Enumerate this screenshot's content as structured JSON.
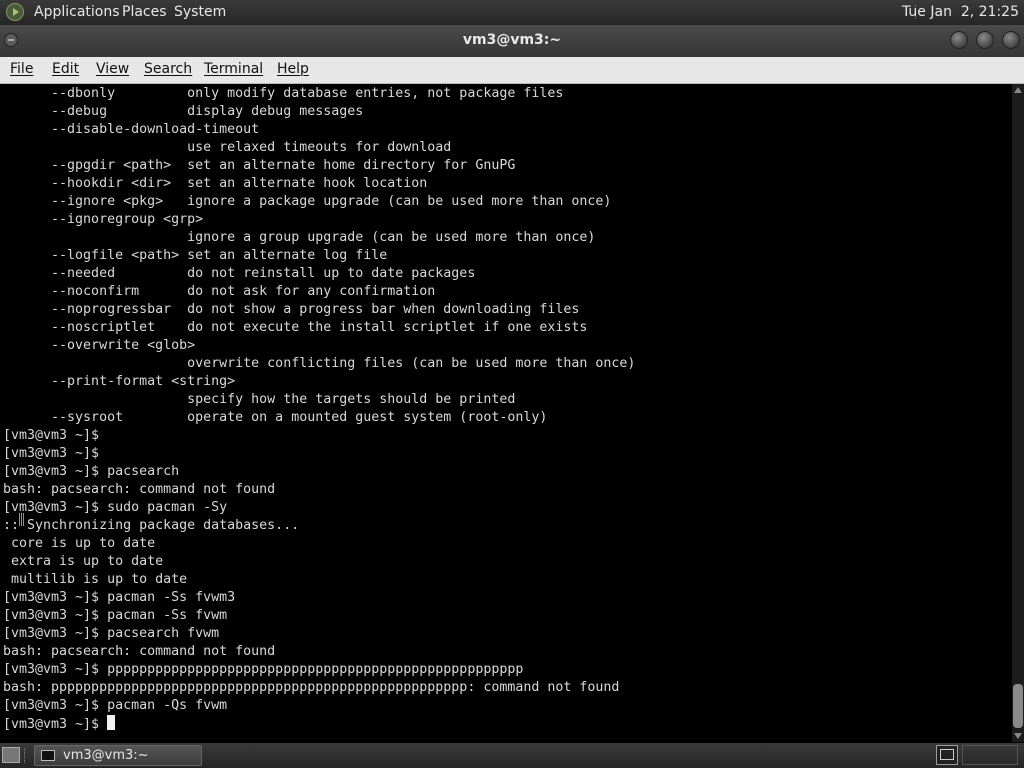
{
  "top_panel": {
    "menus": [
      "Applications",
      "Places",
      "System"
    ],
    "clock": "Tue Jan  2, 21:25"
  },
  "window": {
    "title": "vm3@vm3:~"
  },
  "menubar": {
    "items": [
      "File",
      "Edit",
      "View",
      "Search",
      "Terminal",
      "Help"
    ]
  },
  "terminal": {
    "lines": [
      "      --dbonly         only modify database entries, not package files",
      "      --debug          display debug messages",
      "      --disable-download-timeout",
      "                       use relaxed timeouts for download",
      "      --gpgdir <path>  set an alternate home directory for GnuPG",
      "      --hookdir <dir>  set an alternate hook location",
      "      --ignore <pkg>   ignore a package upgrade (can be used more than once)",
      "      --ignoregroup <grp>",
      "                       ignore a group upgrade (can be used more than once)",
      "      --logfile <path> set an alternate log file",
      "      --needed         do not reinstall up to date packages",
      "      --noconfirm      do not ask for any confirmation",
      "      --noprogressbar  do not show a progress bar when downloading files",
      "      --noscriptlet    do not execute the install scriptlet if one exists",
      "      --overwrite <glob>",
      "                       overwrite conflicting files (can be used more than once)",
      "      --print-format <string>",
      "                       specify how the targets should be printed",
      "      --sysroot        operate on a mounted guest system (root-only)",
      "[vm3@vm3 ~]$",
      "[vm3@vm3 ~]$",
      "[vm3@vm3 ~]$ pacsearch",
      "bash: pacsearch: command not found",
      "[vm3@vm3 ~]$ sudo pacman -Sy",
      ":: Synchronizing package databases...",
      " core is up to date",
      " extra is up to date",
      " multilib is up to date",
      "[vm3@vm3 ~]$ pacman -Ss fvwm3",
      "[vm3@vm3 ~]$ pacman -Ss fvwm",
      "[vm3@vm3 ~]$ pacsearch fvwm",
      "bash: pacsearch: command not found",
      "[vm3@vm3 ~]$ pppppppppppppppppppppppppppppppppppppppppppppppppppp",
      "bash: pppppppppppppppppppppppppppppppppppppppppppppppppppp: command not found",
      "[vm3@vm3 ~]$ pacman -Qs fvwm",
      "[vm3@vm3 ~]$ "
    ]
  },
  "taskbar": {
    "task_label": "vm3@vm3:~"
  },
  "icons": {
    "distro": "arch-logo-icon",
    "window_menu": "window-menu-icon",
    "minimize": "minimize-icon",
    "maximize": "maximize-icon",
    "close": "close-icon",
    "terminal": "terminal-icon",
    "workspace": "workspace-switcher-icon"
  }
}
